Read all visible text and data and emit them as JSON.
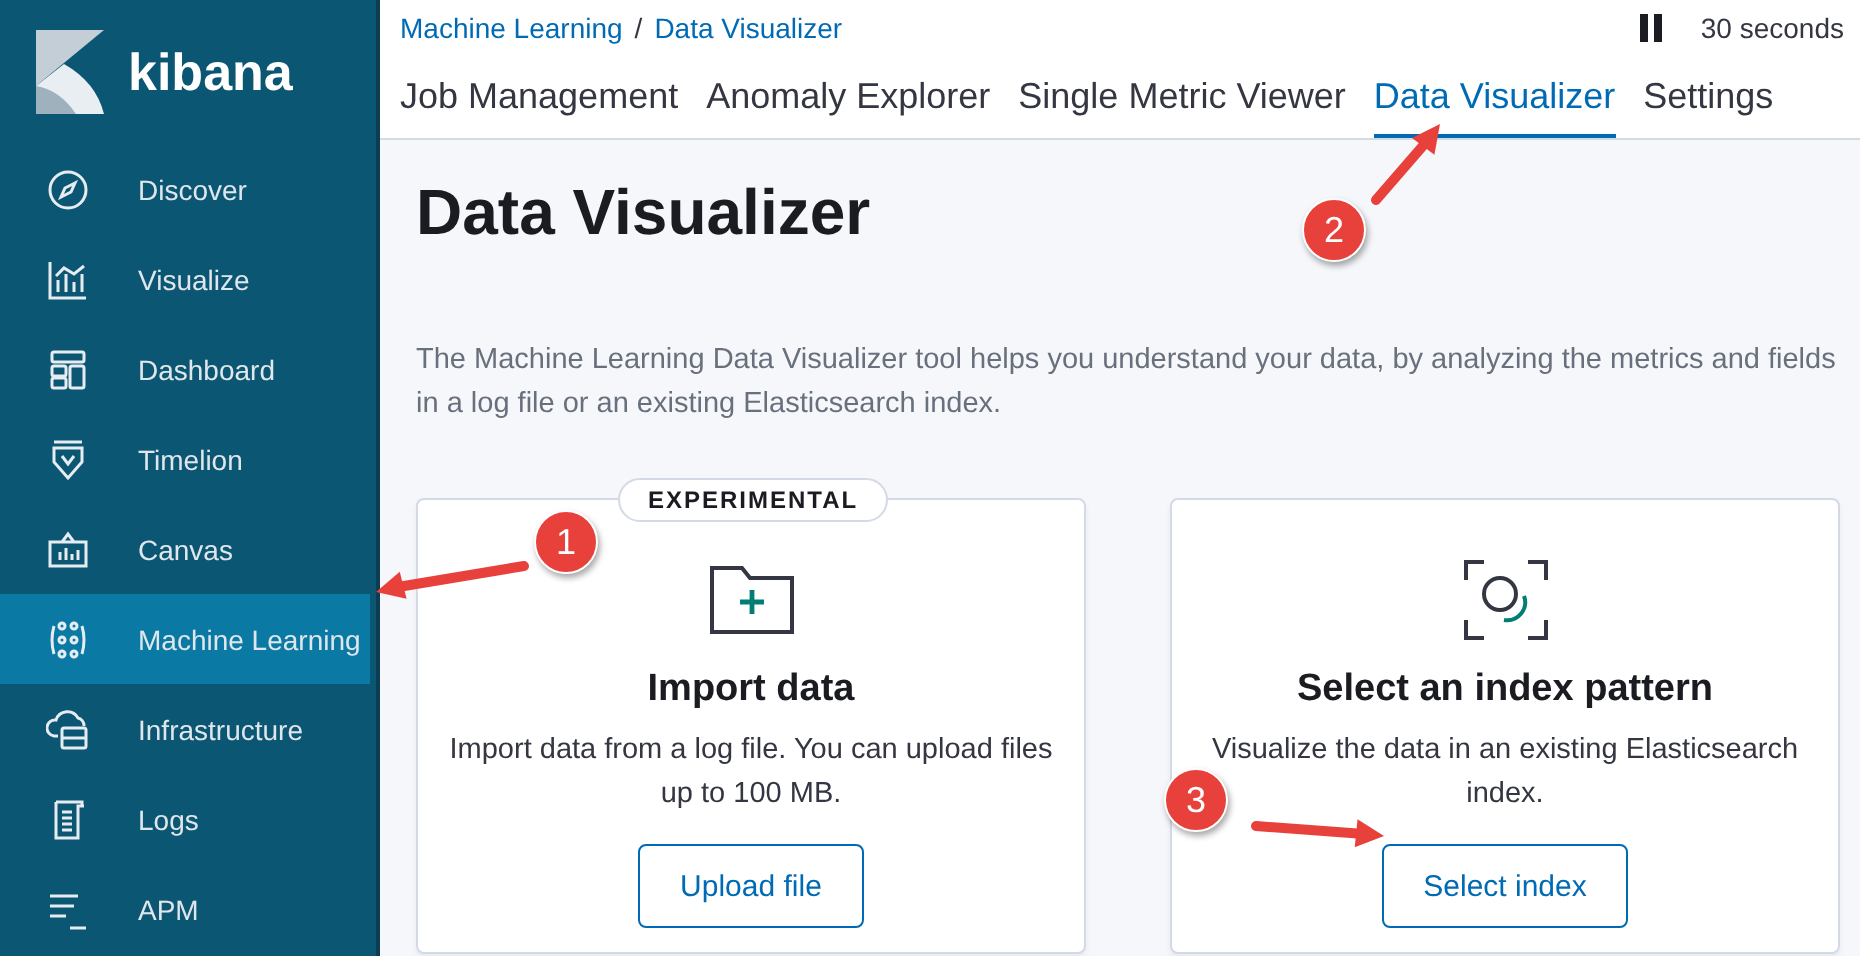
{
  "brand": {
    "name": "kibana"
  },
  "nav": [
    {
      "label": "Discover",
      "selected": false
    },
    {
      "label": "Visualize",
      "selected": false
    },
    {
      "label": "Dashboard",
      "selected": false
    },
    {
      "label": "Timelion",
      "selected": false
    },
    {
      "label": "Canvas",
      "selected": false
    },
    {
      "label": "Machine Learning",
      "selected": true
    },
    {
      "label": "Infrastructure",
      "selected": false
    },
    {
      "label": "Logs",
      "selected": false
    },
    {
      "label": "APM",
      "selected": false
    }
  ],
  "breadcrumbs": [
    "Machine Learning",
    "Data Visualizer"
  ],
  "breadcrumb_separator": "/",
  "refresh": {
    "interval": "30 seconds",
    "paused": true
  },
  "tabs": [
    {
      "label": "Job Management",
      "selected": false
    },
    {
      "label": "Anomaly Explorer",
      "selected": false
    },
    {
      "label": "Single Metric Viewer",
      "selected": false
    },
    {
      "label": "Data Visualizer",
      "selected": true
    },
    {
      "label": "Settings",
      "selected": false
    }
  ],
  "page": {
    "title": "Data Visualizer",
    "description": "The Machine Learning Data Visualizer tool helps you understand your data, by analyzing the metrics and fields in a log file or an existing Elasticsearch index."
  },
  "cards": [
    {
      "badge": "EXPERIMENTAL",
      "title": "Import data",
      "text": "Import data from a log file. You can upload files up to 100 MB.",
      "button": "Upload file"
    },
    {
      "title": "Select an index pattern",
      "text": "Visualize the data in an existing Elasticsearch index.",
      "button": "Select index"
    }
  ],
  "callouts": [
    {
      "number": "1"
    },
    {
      "number": "2"
    },
    {
      "number": "3"
    }
  ]
}
